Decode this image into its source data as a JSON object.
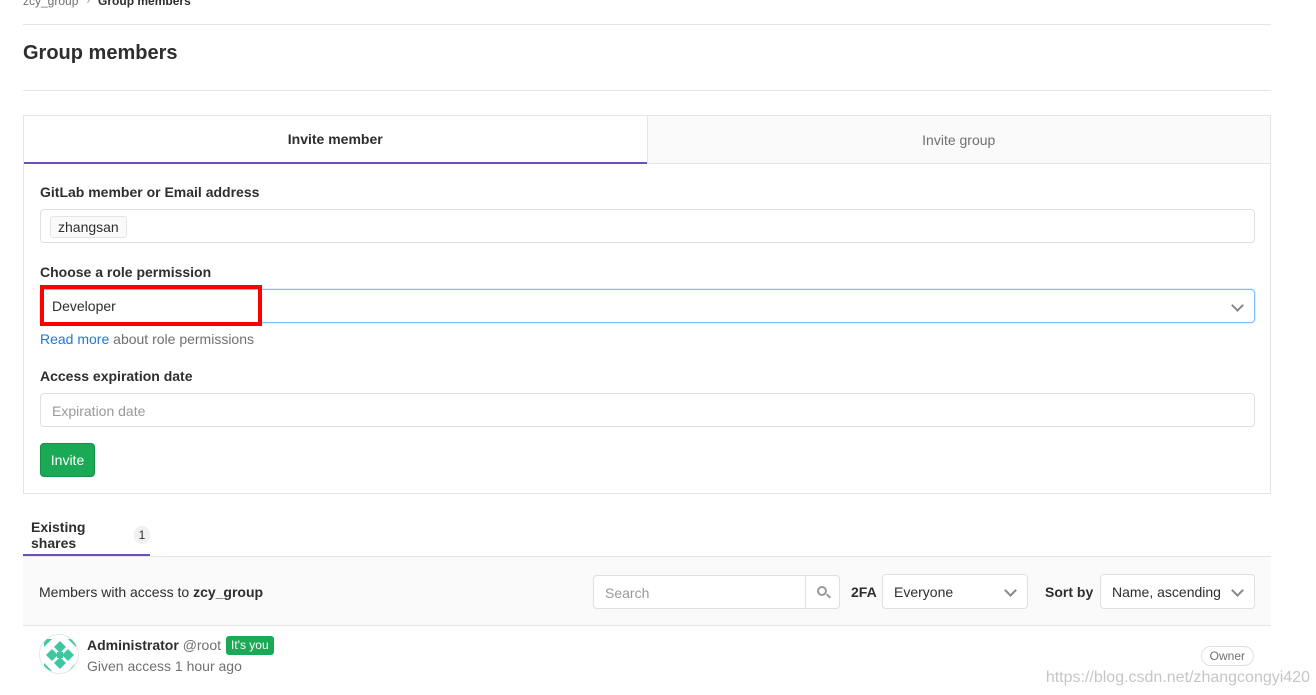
{
  "breadcrumb": {
    "parent": "zcy_group",
    "current": "Group members"
  },
  "page": {
    "title": "Group members"
  },
  "invite": {
    "tabs": [
      {
        "label": "Invite member"
      },
      {
        "label": "Invite group"
      }
    ],
    "member_label": "GitLab member or Email address",
    "member_token": "zhangsan",
    "role_label": "Choose a role permission",
    "role_value": "Developer",
    "help_link": "Read more",
    "help_text": " about role permissions",
    "expiration_label": "Access expiration date",
    "expiration_placeholder": "Expiration date",
    "invite_button": "Invite"
  },
  "shares": {
    "tab_label": "Existing shares",
    "count": "1"
  },
  "members_bar": {
    "prefix": "Members with access to ",
    "group": "zcy_group",
    "search_placeholder": "Search",
    "twofa_label": "2FA",
    "twofa_value": "Everyone",
    "sort_label": "Sort by",
    "sort_value": "Name, ascending"
  },
  "member": {
    "name": "Administrator",
    "username": "@root",
    "you_badge": "It's you",
    "meta": "Given access 1 hour ago",
    "role": "Owner"
  },
  "watermark": "https://blog.csdn.net/zhangcongyi420",
  "colors": {
    "accent": "#6b4fbb",
    "success": "#1aaa55",
    "link": "#1f78d1",
    "highlight": "#ff0000"
  }
}
